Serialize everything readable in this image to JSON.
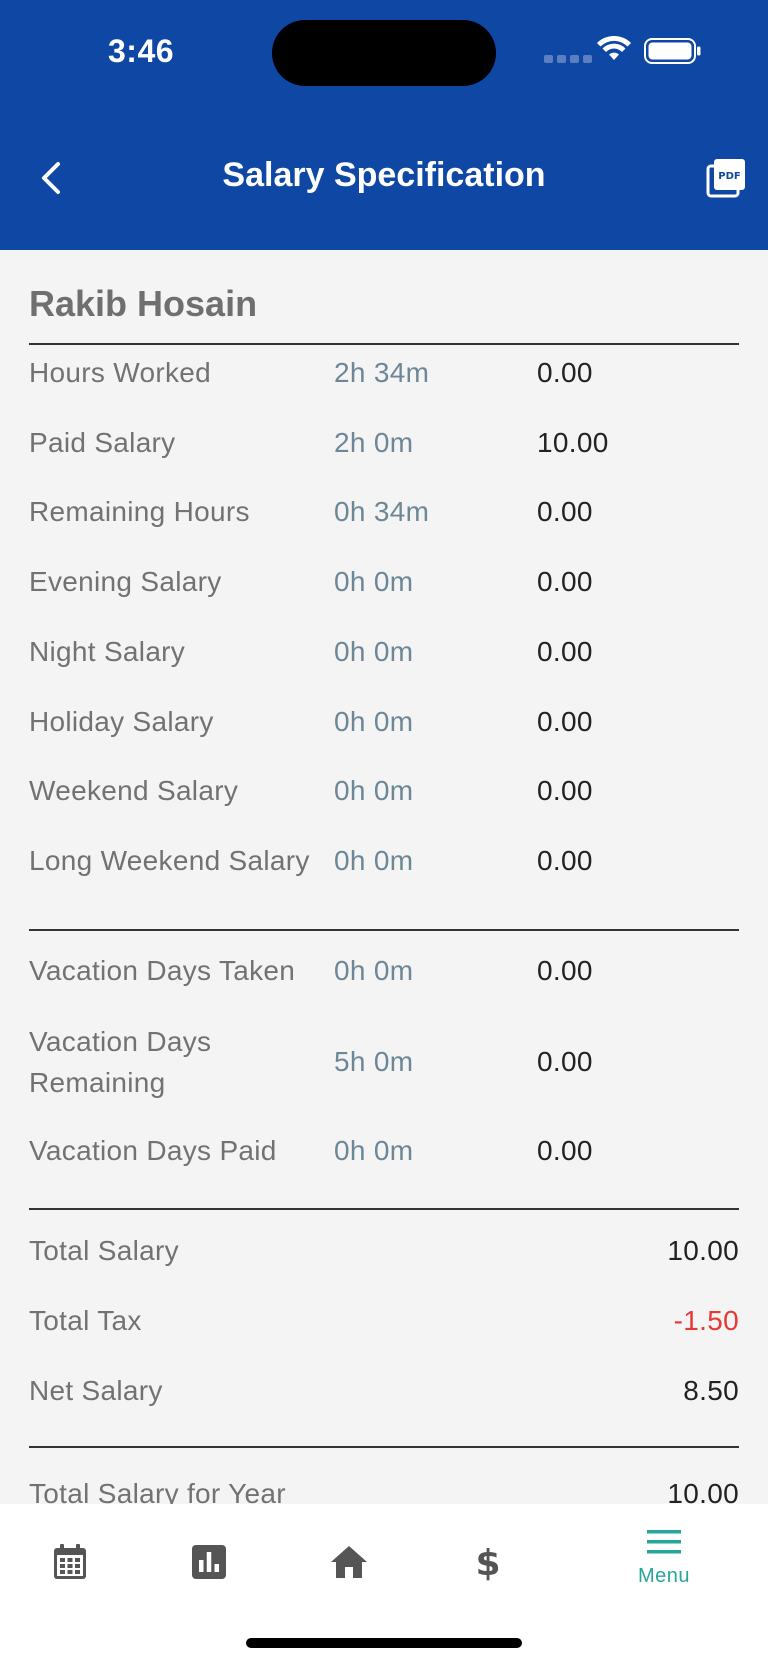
{
  "status": {
    "time": "3:46"
  },
  "header": {
    "title": "Salary Specification",
    "back_icon": "chevron-left-icon",
    "pdf_icon": "pdf-icon"
  },
  "employee": {
    "name": "Rakib Hosain"
  },
  "work_rows": [
    {
      "label": "Hours Worked",
      "hours": "2h 34m",
      "amount": "0.00"
    },
    {
      "label": "Paid Salary",
      "hours": "2h 0m",
      "amount": "10.00"
    },
    {
      "label": "Remaining Hours",
      "hours": "0h 34m",
      "amount": "0.00"
    },
    {
      "label": "Evening Salary",
      "hours": "0h 0m",
      "amount": "0.00"
    },
    {
      "label": "Night Salary",
      "hours": "0h 0m",
      "amount": "0.00"
    },
    {
      "label": "Holiday Salary",
      "hours": "0h 0m",
      "amount": "0.00"
    },
    {
      "label": "Weekend Salary",
      "hours": "0h 0m",
      "amount": "0.00"
    },
    {
      "label": "Long Weekend Salary",
      "hours": "0h 0m",
      "amount": "0.00"
    }
  ],
  "vacation_rows": [
    {
      "label": "Vacation Days Taken",
      "hours": "0h 0m",
      "amount": "0.00"
    },
    {
      "label": "Vacation Days Remaining",
      "hours": "5h 0m",
      "amount": "0.00"
    },
    {
      "label": "Vacation Days Paid",
      "hours": "0h 0m",
      "amount": "0.00"
    }
  ],
  "totals": [
    {
      "label": "Total Salary",
      "amount": "10.00"
    },
    {
      "label": "Total Tax",
      "amount": "-1.50"
    },
    {
      "label": "Net Salary",
      "amount": "8.50"
    }
  ],
  "year_total": {
    "label": "Total Salary for Year",
    "amount": "10.00"
  },
  "colors": {
    "header_bg": "#0e47a4",
    "accent": "#26a69a",
    "negative": "#e53935",
    "hours_text": "#6e8796"
  },
  "bottom_nav": {
    "items": [
      {
        "icon": "calendar-icon"
      },
      {
        "icon": "chart-icon"
      },
      {
        "icon": "home-icon"
      },
      {
        "icon": "dollar-icon"
      },
      {
        "icon": "menu-icon",
        "label": "Menu",
        "active": true
      }
    ]
  }
}
